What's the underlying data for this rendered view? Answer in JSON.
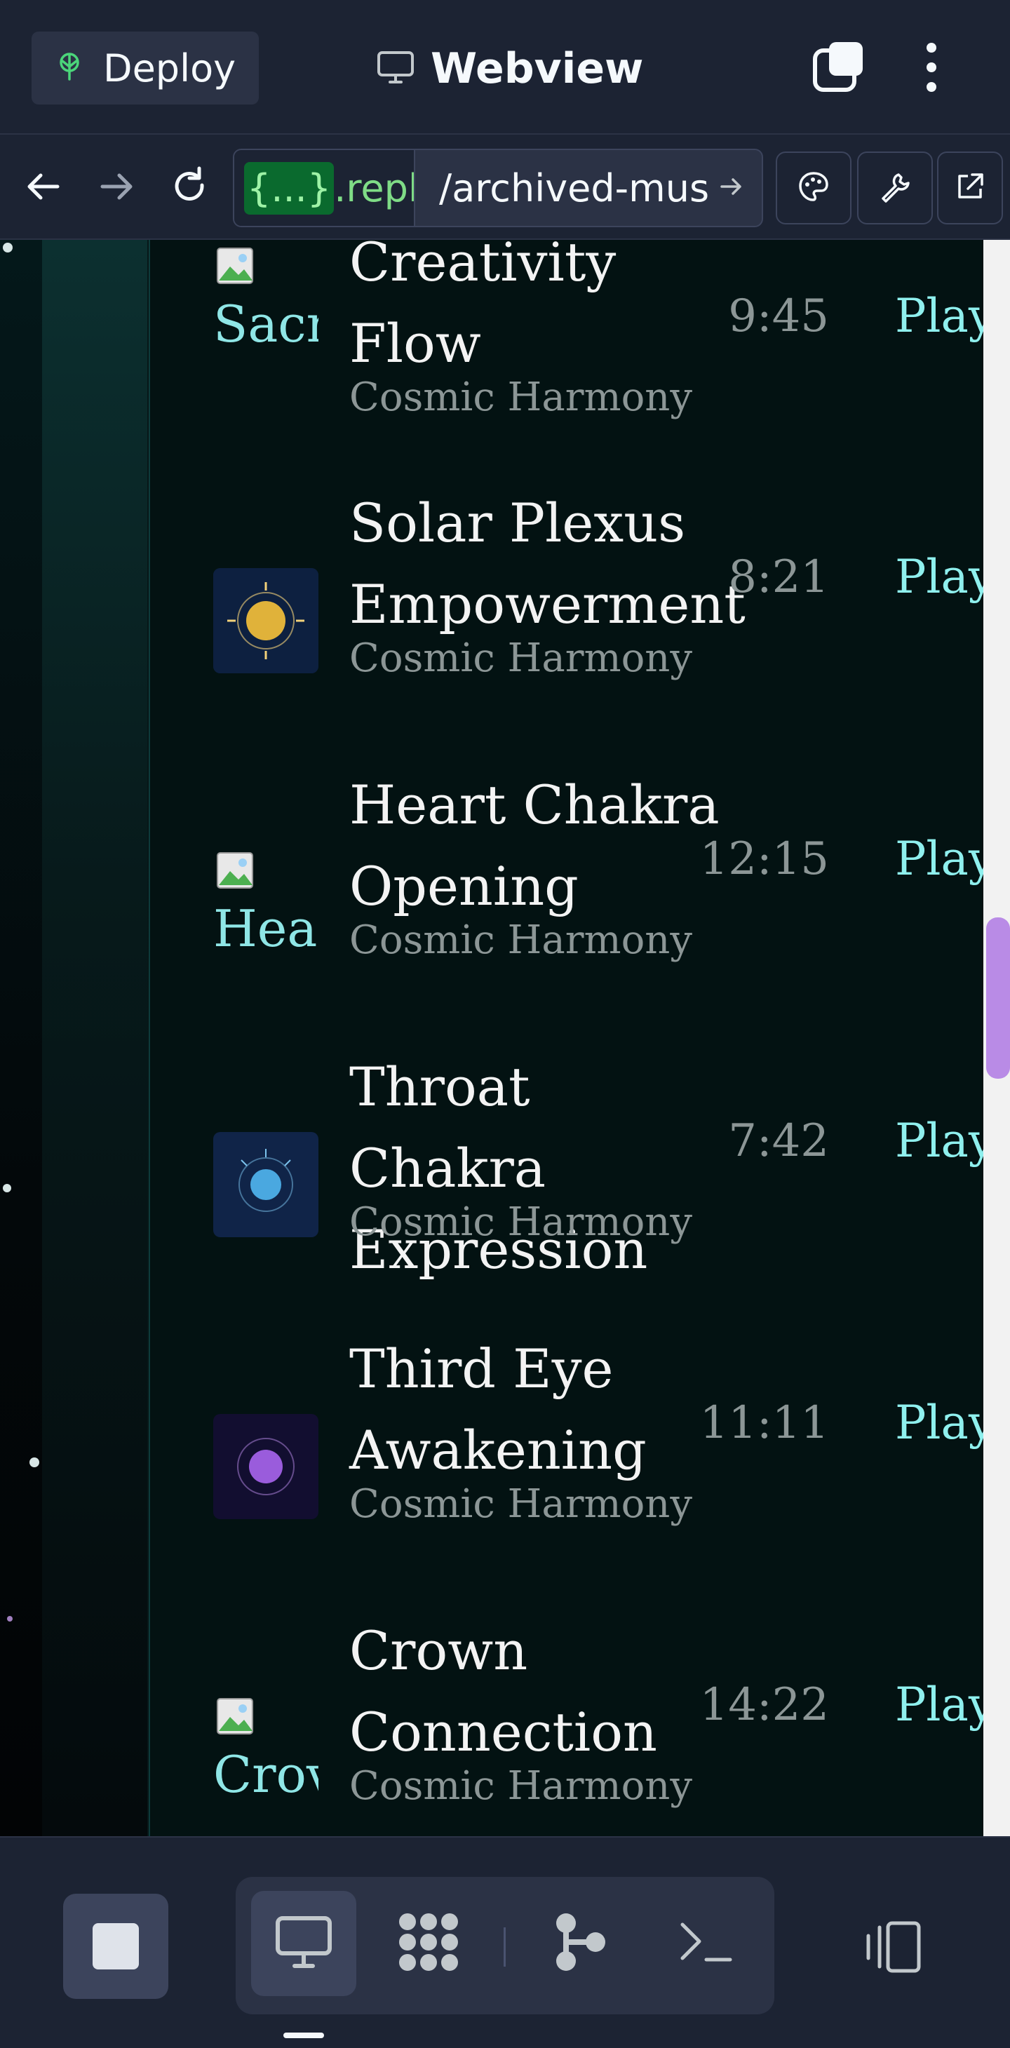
{
  "topbar": {
    "deploy_label": "Deploy",
    "title": "Webview"
  },
  "navbar": {
    "url_badge": "{...}",
    "url_host_rest": ".repl",
    "url_path": "/archived-mus"
  },
  "tracks": [
    {
      "title": "Creativity Flow",
      "artist": "Cosmic Harmony",
      "duration": "9:45",
      "play_label": "Play",
      "thumb_alt": "Sacr",
      "thumb_kind": "broken"
    },
    {
      "title": "Solar Plexus Empowerment",
      "artist": "Cosmic Harmony",
      "duration": "8:21",
      "play_label": "Play",
      "thumb_kind": "image",
      "thumb_color": "#e0b23a"
    },
    {
      "title": "Heart Chakra Opening",
      "artist": "Cosmic Harmony",
      "duration": "12:15",
      "play_label": "Play",
      "thumb_alt": "Hea",
      "thumb_kind": "broken"
    },
    {
      "title": "Throat Chakra Expression",
      "artist": "Cosmic Harmony",
      "duration": "7:42",
      "play_label": "Play",
      "thumb_kind": "image",
      "thumb_color": "#4aa8e0"
    },
    {
      "title": "Third Eye Awakening",
      "artist": "Cosmic Harmony",
      "duration": "11:11",
      "play_label": "Play",
      "thumb_kind": "image",
      "thumb_color": "#9a5cdc"
    },
    {
      "title": "Crown Connection",
      "artist": "Cosmic Harmony",
      "duration": "14:22",
      "play_label": "Play",
      "thumb_alt": "Crov",
      "thumb_kind": "broken"
    }
  ],
  "colors": {
    "accent_play": "#8ff0ee",
    "scrollbar_thumb": "#b98be6",
    "panel_bg": "#031212"
  }
}
